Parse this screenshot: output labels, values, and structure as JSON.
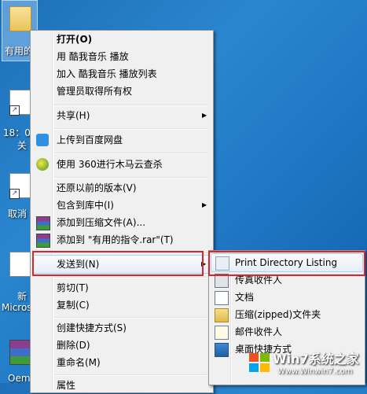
{
  "desktop": {
    "icons": [
      {
        "label": "有用的",
        "type": "folder"
      },
      {
        "label": "18：0",
        "sub": "关",
        "type": "shortcut"
      },
      {
        "label": "取消",
        "type": "shortcut"
      },
      {
        "label": "新",
        "sub": "Micros",
        "type": "document"
      },
      {
        "label": "Oem",
        "type": "rar"
      }
    ]
  },
  "context_menu": {
    "items": [
      {
        "label": "打开(O)",
        "bold": true
      },
      {
        "label": "用 酷我音乐 播放"
      },
      {
        "label": "加入 酷我音乐 播放列表"
      },
      {
        "label": "管理员取得所有权"
      },
      {
        "label": "共享(H)",
        "submenu": true
      },
      {
        "label": "上传到百度网盘",
        "icon": "baidu-cloud-icon"
      },
      {
        "label": "使用 360进行木马云查杀",
        "icon": "360-icon"
      },
      {
        "label": "还原以前的版本(V)"
      },
      {
        "label": "包含到库中(I)",
        "submenu": true
      },
      {
        "label": "添加到压缩文件(A)...",
        "icon": "winrar-icon"
      },
      {
        "label": "添加到 \"有用的指令.rar\"(T)",
        "icon": "winrar-icon"
      },
      {
        "label": "发送到(N)",
        "submenu": true
      },
      {
        "label": "剪切(T)"
      },
      {
        "label": "复制(C)"
      },
      {
        "label": "创建快捷方式(S)"
      },
      {
        "label": "删除(D)"
      },
      {
        "label": "重命名(M)"
      },
      {
        "label": "属性"
      }
    ]
  },
  "send_to_menu": {
    "items": [
      {
        "label": "Print Directory Listing",
        "icon": "print-directory-icon"
      },
      {
        "label": "传真收件人",
        "icon": "fax-icon"
      },
      {
        "label": "文档",
        "icon": "documents-icon"
      },
      {
        "label": "压缩(zipped)文件夹",
        "icon": "zip-folder-icon"
      },
      {
        "label": "邮件收件人",
        "icon": "mail-icon"
      },
      {
        "label": "桌面快捷方式",
        "icon": "desktop-shortcut-icon"
      }
    ]
  },
  "watermark": {
    "title": "Win7系统之家",
    "url": "Www.Winwin7.com"
  },
  "colors": {
    "highlight_border": "#d8262a",
    "menu_bg": "#f0f0f0"
  }
}
